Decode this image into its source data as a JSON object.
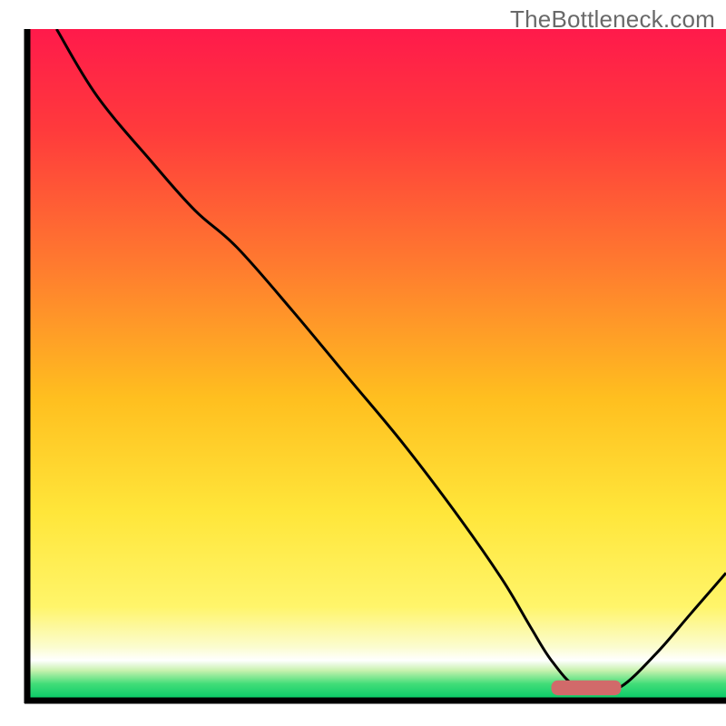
{
  "watermark": "TheBottleneck.com",
  "chart_data": {
    "type": "line",
    "title": "",
    "xlabel": "",
    "ylabel": "",
    "xlim": [
      0,
      100
    ],
    "ylim": [
      0,
      100
    ],
    "grid": false,
    "legend": false,
    "annotations": [],
    "axes_visible": {
      "left": true,
      "bottom": true,
      "top": false,
      "right": false
    },
    "gradient_bands": {
      "description": "vertical gradient inside plot from red at top through orange, yellow to green at bottom, with a narrow white band separating yellow and green",
      "stops": [
        {
          "offset": 0.0,
          "y": 100,
          "color": "#ff1a4b"
        },
        {
          "offset": 0.15,
          "y": 85,
          "color": "#ff3a3c"
        },
        {
          "offset": 0.35,
          "y": 65,
          "color": "#ff7a2f"
        },
        {
          "offset": 0.55,
          "y": 45,
          "color": "#ffbf1f"
        },
        {
          "offset": 0.72,
          "y": 28,
          "color": "#ffe63a"
        },
        {
          "offset": 0.86,
          "y": 14,
          "color": "#fff56a"
        },
        {
          "offset": 0.92,
          "y": 8,
          "color": "#fbfccf"
        },
        {
          "offset": 0.94,
          "y": 6,
          "color": "#ffffff"
        },
        {
          "offset": 0.955,
          "y": 4.5,
          "color": "#c8f2af"
        },
        {
          "offset": 0.975,
          "y": 2.5,
          "color": "#42dd78"
        },
        {
          "offset": 1.0,
          "y": 0,
          "color": "#00c765"
        }
      ]
    },
    "series": [
      {
        "name": "bottleneck-curve",
        "color": "#000000",
        "stroke_width": 3,
        "x": [
          4.2,
          10,
          18,
          24,
          30,
          38,
          46,
          54,
          62,
          68,
          72,
          75,
          78.5,
          82,
          85,
          90,
          95,
          100
        ],
        "y": [
          100,
          90,
          80,
          73,
          67.5,
          58,
          48,
          38,
          27,
          18,
          11,
          6,
          2.1,
          1.9,
          2.1,
          7,
          13,
          19
        ]
      }
    ],
    "markers": [
      {
        "name": "optimal-zone-marker",
        "shape": "rounded-bar",
        "color": "#d16a6a",
        "x_center": 80,
        "x_span": 10,
        "y": 1.9,
        "thickness_y": 2.2
      }
    ]
  }
}
